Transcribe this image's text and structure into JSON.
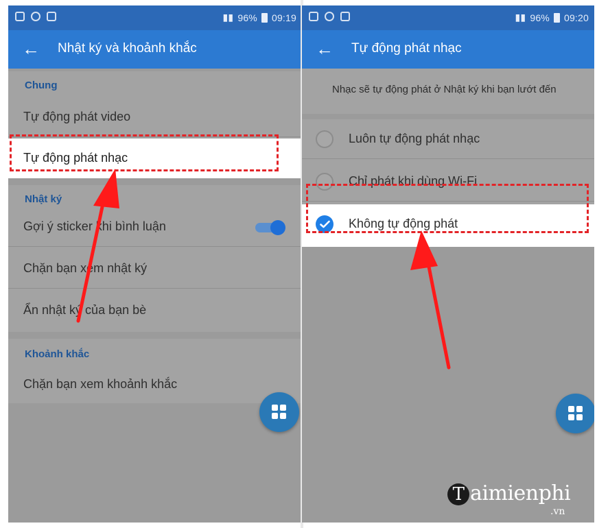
{
  "colors": {
    "status_bar": "#2c69b7",
    "app_bar": "#2c7ad2",
    "section_header": "#1e5597",
    "highlight_box": "#e32428",
    "fab": "#2a79b6",
    "checked_radio": "#1f7fe6"
  },
  "left": {
    "status": {
      "battery": "96%",
      "time": "09:19"
    },
    "title": "Nhật ký và khoảnh khắc",
    "sections": [
      {
        "header": "Chung",
        "items": [
          "Tự động phát video",
          "Tự động phát nhạc"
        ]
      },
      {
        "header": "Nhật ký",
        "items": [
          "Gợi ý sticker khi bình luận",
          "Chặn bạn xem nhật ký",
          "Ẩn nhật ký của bạn bè"
        ]
      },
      {
        "header": "Khoảnh khắc",
        "items": [
          "Chặn bạn xem khoảnh khắc"
        ]
      }
    ],
    "toggle_sticker_on": true,
    "highlighted_item": "Tự động phát nhạc"
  },
  "right": {
    "status": {
      "battery": "96%",
      "time": "09:20"
    },
    "title": "Tự động phát nhạc",
    "caption": "Nhạc sẽ tự động phát ở Nhật ký khi bạn lướt đến",
    "options": [
      {
        "label": "Luôn tự động phát nhạc",
        "selected": false
      },
      {
        "label": "Chỉ phát khi dùng Wi-Fi",
        "selected": false
      },
      {
        "label": "Không tự động phát",
        "selected": true
      }
    ]
  },
  "icons": {
    "back": "arrow-left-icon",
    "fab": "grid-apps-icon",
    "check": "checkmark-icon"
  },
  "watermark": {
    "brand": "aimienphi",
    "brand_initial": "T",
    "domain": ".vn"
  }
}
